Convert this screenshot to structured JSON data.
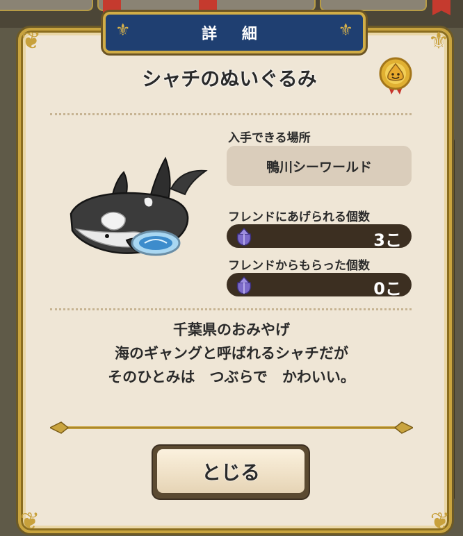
{
  "header": {
    "title": "詳 細"
  },
  "item": {
    "name": "シャチのぬいぐるみ"
  },
  "location": {
    "label": "入手できる場所",
    "value": "鴨川シーワールド"
  },
  "give_count": {
    "label": "フレンドにあげられる個数",
    "value": "3こ"
  },
  "received_count": {
    "label": "フレンドからもらった個数",
    "value": "0こ"
  },
  "description": {
    "line1": "千葉県のおみやげ",
    "line2": "海のギャングと呼ばれるシャチだが",
    "line3": "そのひとみは　つぶらで　かわいい。"
  },
  "buttons": {
    "close_label": "とじる"
  },
  "icons": {
    "badge": "slime-medal-icon",
    "gift": "gift-bag-icon",
    "item": "orca-plush-icon"
  },
  "colors": {
    "header_bg": "#1f3f71",
    "gold": "#c9a43f",
    "panel_bg": "#efe6d6",
    "count_bar": "#3c2f21"
  }
}
